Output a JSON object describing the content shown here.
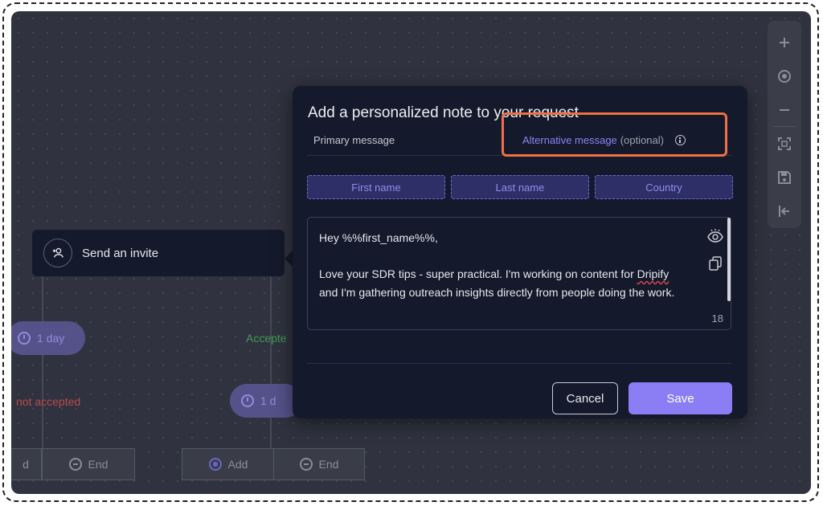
{
  "canvas": {
    "pill_delay_1": "1 day",
    "pill_delay_2": "1 d",
    "accepted_label": "Accepte",
    "not_accepted_label": "not accepted",
    "node_buttons": [
      {
        "label": "d"
      },
      {
        "label": "End"
      },
      {
        "label": "Add"
      },
      {
        "label": "End"
      }
    ]
  },
  "toolbar": {
    "icons": [
      "plus-icon",
      "target-icon",
      "minus-icon",
      "fit-screen-icon",
      "save-icon",
      "exit-icon"
    ]
  },
  "invite_node": {
    "label": "Send an invite",
    "icon": "add-user-icon"
  },
  "modal": {
    "title": "Add a personalized note to your request",
    "tabs": {
      "primary": "Primary message",
      "alternative": "Alternative message",
      "alternative_suffix": "(optional)"
    },
    "variables": [
      "First name",
      "Last name",
      "Country"
    ],
    "message_line1": "Hey %%first_name%%,",
    "message_line2a": "Love your SDR tips - super practical. I'm working on content for ",
    "message_word_flagged": "Dripify",
    "message_line2b": " and I'm gathering outreach insights directly from people doing the work.",
    "char_counter": "18",
    "cancel_label": "Cancel",
    "save_label": "Save"
  },
  "colors": {
    "accent": "#8b7ef5",
    "highlight": "#f07043",
    "accepted": "#3f9a55",
    "not_accepted": "#b84a4a"
  }
}
